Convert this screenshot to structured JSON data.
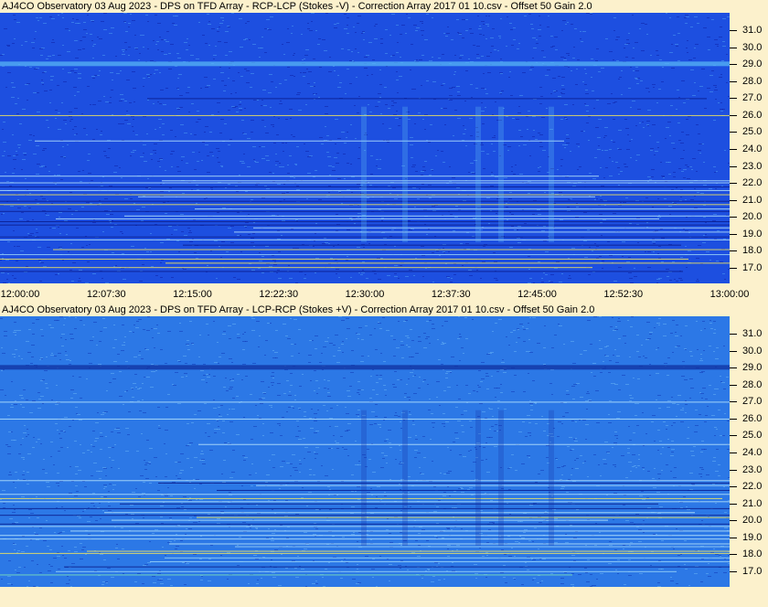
{
  "chart_data": [
    {
      "type": "heatmap",
      "title": "AJ4CO Observatory 03 Aug 2023  -  DPS on TFD Array  -  RCP-LCP (Stokes -V)  -  Correction Array 2017 01 10.csv  -  Offset 50  Gain 2.0",
      "yticks": [
        "31.0",
        "30.0",
        "29.0",
        "28.0",
        "27.0",
        "26.0",
        "25.0",
        "24.0",
        "23.0",
        "22.0",
        "21.0",
        "20.0",
        "19.0",
        "18.0",
        "17.0"
      ],
      "ylim": [
        16.5,
        31.5
      ],
      "xticks": [
        "12:00:00",
        "12:07:30",
        "12:15:00",
        "12:22:30",
        "12:30:00",
        "12:37:30",
        "12:45:00",
        "12:52:30",
        "13:00:00"
      ],
      "xlim": [
        "12:00:00",
        "13:00:00"
      ],
      "colors": {
        "base": "#1d4fe0",
        "noise_hi": "#4a9bf0",
        "noise_lo": "#0c22a8",
        "hot": "#f3e65a"
      }
    },
    {
      "type": "heatmap",
      "title": "AJ4CO Observatory 03 Aug 2023  -  DPS on TFD Array  -  LCP-RCP (Stokes +V)  -  Correction Array 2017 01 10.csv  -  Offset 50  Gain 2.0",
      "yticks": [
        "31.0",
        "30.0",
        "29.0",
        "28.0",
        "27.0",
        "26.0",
        "25.0",
        "24.0",
        "23.0",
        "22.0",
        "21.0",
        "20.0",
        "19.0",
        "18.0",
        "17.0"
      ],
      "ylim": [
        16.5,
        31.5
      ],
      "colors": {
        "base": "#2c78e6",
        "noise_hi": "#66b0f4",
        "noise_lo": "#123ab8",
        "hot": "#f3e65a"
      }
    }
  ]
}
